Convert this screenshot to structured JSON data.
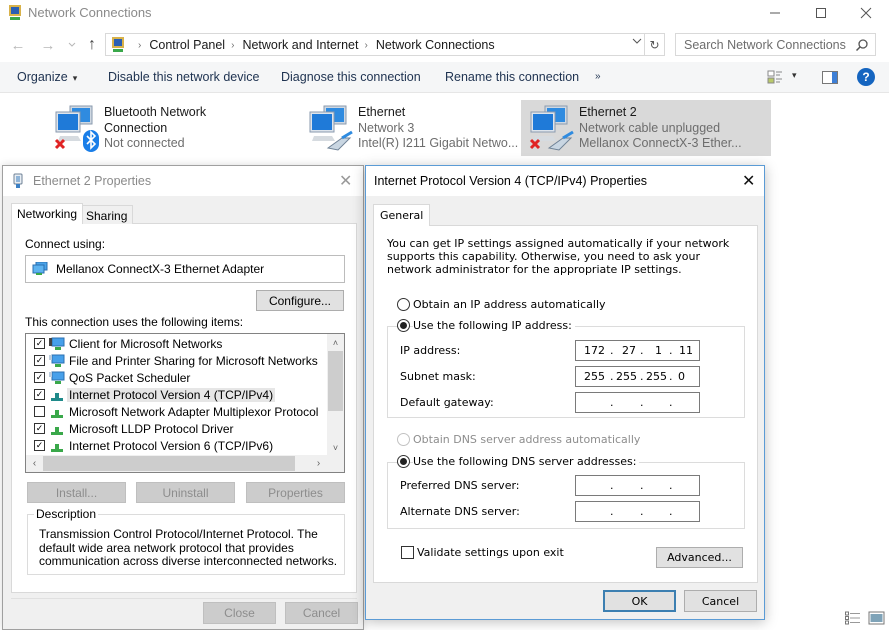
{
  "window": {
    "title": "Network Connections",
    "controls": {
      "minimize": "—",
      "maximize": "☐",
      "close": "✕"
    }
  },
  "address": {
    "back": "←",
    "forward": "→",
    "recent": "⌄",
    "up": "↑",
    "breadcrumbs": [
      "Control Panel",
      "Network and Internet",
      "Network Connections"
    ],
    "separator": "›",
    "dropdown": "⌄",
    "refresh": "↻",
    "search_placeholder": "Search Network Connections"
  },
  "toolbar": {
    "organize": "Organize",
    "organize_caret": "▾",
    "disable": "Disable this network device",
    "diagnose": "Diagnose this connection",
    "rename": "Rename this connection",
    "more": "»",
    "view_caret": "▾",
    "help": "?"
  },
  "connections": [
    {
      "name": "Bluetooth Network Connection",
      "line1": "Bluetooth Network",
      "line2": "Connection",
      "status": "Not connected",
      "device": "",
      "icon": "bluetooth-icon",
      "error": true,
      "selected": false
    },
    {
      "name": "Ethernet",
      "line1": "Ethernet",
      "line2": "",
      "status": "Network 3",
      "device": "Intel(R) I211 Gigabit Netwo...",
      "icon": "ethernet-cable-icon",
      "error": false,
      "selected": false
    },
    {
      "name": "Ethernet 2",
      "line1": "Ethernet 2",
      "line2": "",
      "status": "Network cable unplugged",
      "device": "Mellanox ConnectX-3 Ether...",
      "icon": "ethernet-cable-icon",
      "error": true,
      "selected": true
    }
  ],
  "eth_props": {
    "title": "Ethernet 2 Properties",
    "close": "✕",
    "tabs": [
      "Networking",
      "Sharing"
    ],
    "active_tab": "Networking",
    "connect_using_label": "Connect using:",
    "adapter": "Mellanox ConnectX-3 Ethernet Adapter",
    "configure": "Configure...",
    "items_label": "This connection uses the following items:",
    "items": [
      {
        "label": "Client for Microsoft Networks",
        "checked": true,
        "icon": "network-client-icon"
      },
      {
        "label": "File and Printer Sharing for Microsoft Networks",
        "checked": true,
        "icon": "network-service-icon"
      },
      {
        "label": "QoS Packet Scheduler",
        "checked": true,
        "icon": "network-service-icon"
      },
      {
        "label": "Internet Protocol Version 4 (TCP/IPv4)",
        "checked": true,
        "icon": "protocol-icon",
        "highlighted": true
      },
      {
        "label": "Microsoft Network Adapter Multiplexor Protocol",
        "checked": false,
        "icon": "protocol-icon"
      },
      {
        "label": "Microsoft LLDP Protocol Driver",
        "checked": true,
        "icon": "protocol-icon"
      },
      {
        "label": "Internet Protocol Version 6 (TCP/IPv6)",
        "checked": true,
        "icon": "protocol-icon"
      }
    ],
    "scroll": {
      "up": "˄",
      "down": "˅",
      "left": "‹",
      "right": "›"
    },
    "install": "Install...",
    "uninstall": "Uninstall",
    "properties": "Properties",
    "description_label": "Description",
    "description": "Transmission Control Protocol/Internet Protocol. The default wide area network protocol that provides communication across diverse interconnected networks.",
    "close_btn": "Close",
    "cancel_btn": "Cancel"
  },
  "ipv4": {
    "title": "Internet Protocol Version 4 (TCP/IPv4) Properties",
    "close": "✕",
    "tab": "General",
    "intro": "You can get IP settings assigned automatically if your network supports this capability. Otherwise, you need to ask your network administrator for the appropriate IP settings.",
    "auto_ip": "Obtain an IP address automatically",
    "manual_ip": "Use the following IP address:",
    "ip_mode": "manual",
    "ip_label": "IP address:",
    "ip_octets": [
      "172",
      "27",
      "1",
      "11"
    ],
    "mask_label": "Subnet mask:",
    "mask_octets": [
      "255",
      "255",
      "255",
      "0"
    ],
    "gateway_label": "Default gateway:",
    "gateway_octets": [
      "",
      "",
      "",
      ""
    ],
    "auto_dns": "Obtain DNS server address automatically",
    "manual_dns": "Use the following DNS server addresses:",
    "dns_mode": "manual",
    "pref_dns_label": "Preferred DNS server:",
    "pref_dns_octets": [
      "",
      "",
      "",
      ""
    ],
    "alt_dns_label": "Alternate DNS server:",
    "alt_dns_octets": [
      "",
      "",
      "",
      ""
    ],
    "validate": "Validate settings upon exit",
    "validate_checked": false,
    "advanced": "Advanced...",
    "ok": "OK",
    "cancel": "Cancel",
    "dot": "."
  }
}
